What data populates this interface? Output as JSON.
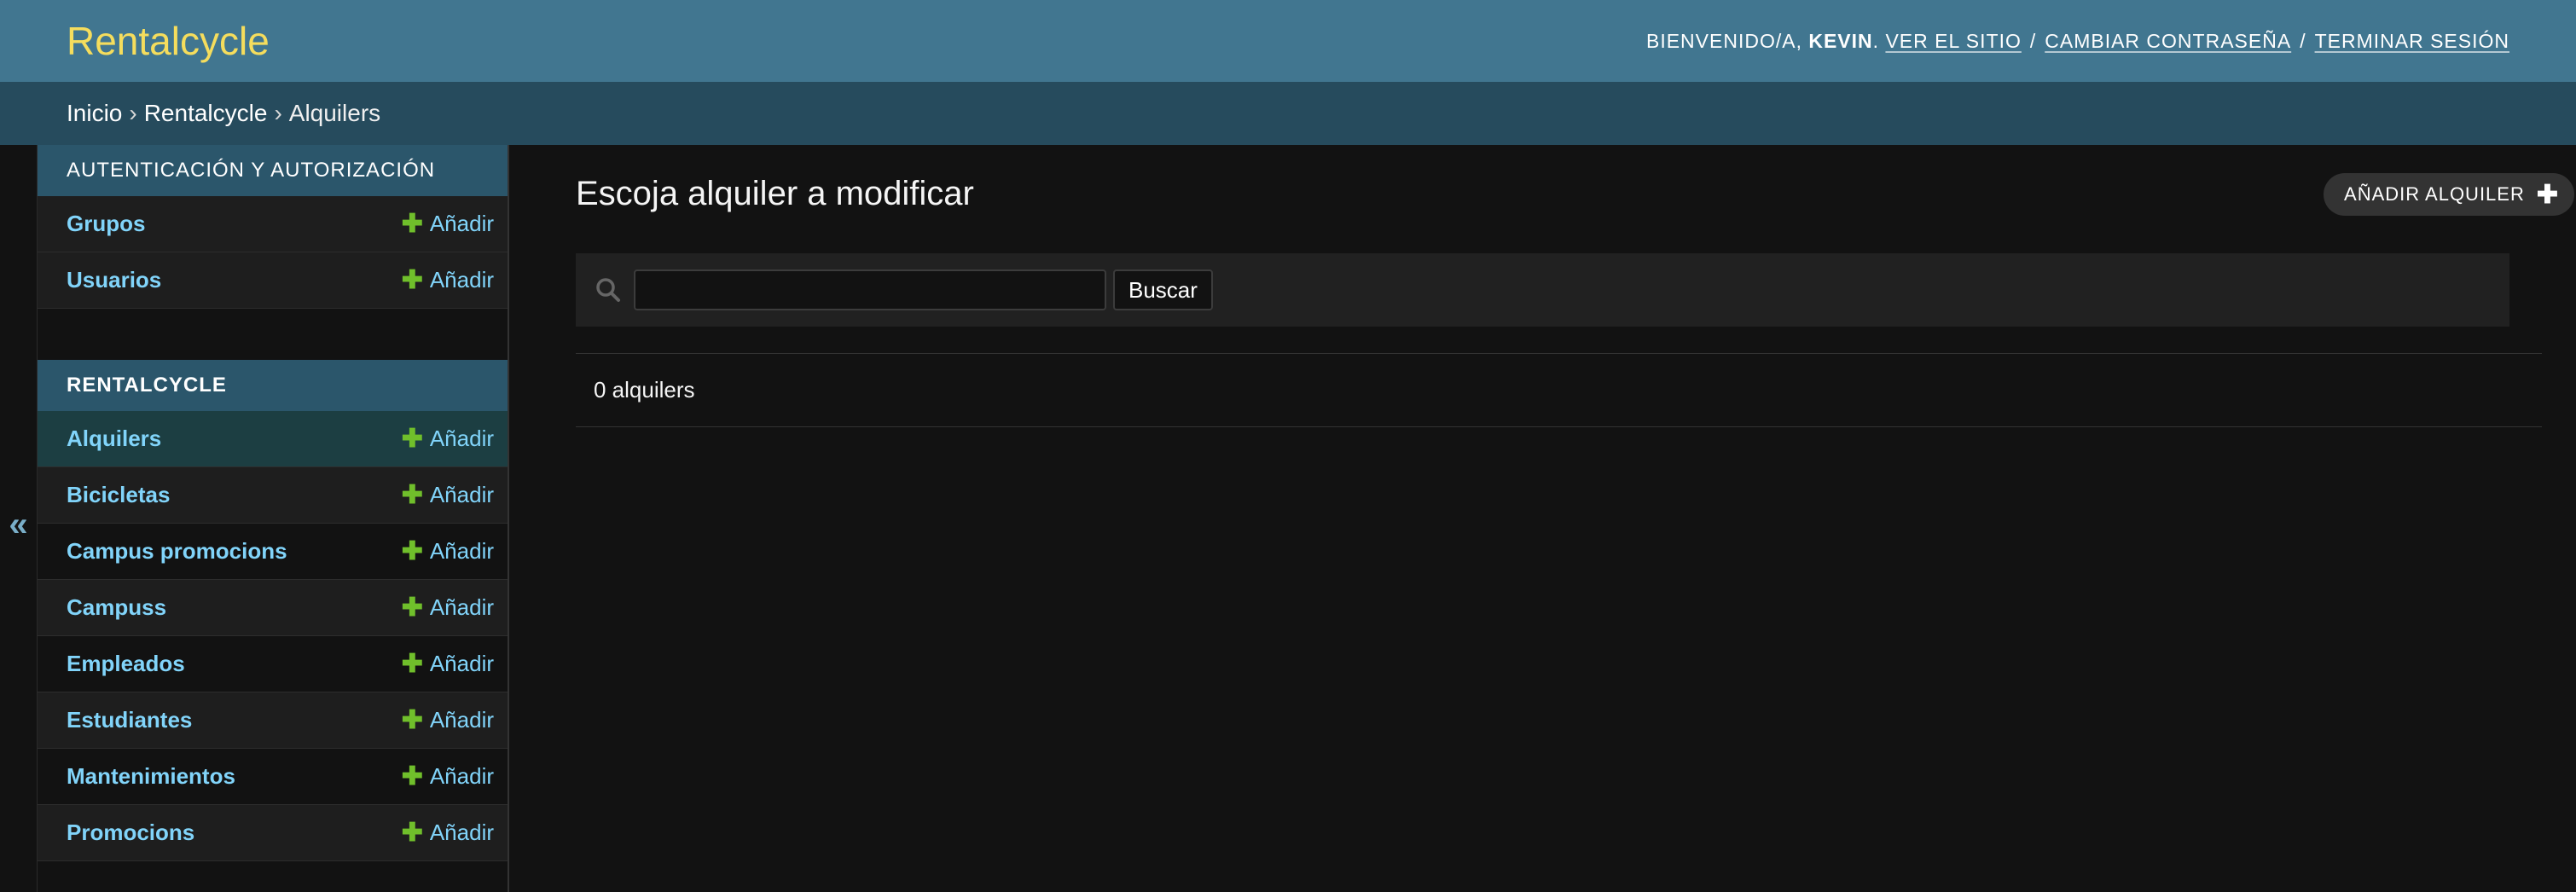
{
  "header": {
    "site_name": "Rentalcycle",
    "welcome_prefix": "BIENVENIDO/A,",
    "username": "KEVIN",
    "after_user": ".",
    "links": [
      "VER EL SITIO",
      "CAMBIAR CONTRASEÑA",
      "TERMINAR SESIÓN"
    ],
    "separator": "/"
  },
  "breadcrumbs": {
    "items": [
      "Inicio",
      "Rentalcycle",
      "Alquilers"
    ],
    "separator": "›"
  },
  "toggle": {
    "label": "«"
  },
  "sidebar": {
    "modules": [
      {
        "caption": "AUTENTICACIÓN Y AUTORIZACIÓN",
        "items": [
          {
            "label": "Grupos",
            "add": "Añadir"
          },
          {
            "label": "Usuarios",
            "add": "Añadir"
          }
        ]
      },
      {
        "caption": "RENTALCYCLE",
        "items": [
          {
            "label": "Alquilers",
            "add": "Añadir"
          },
          {
            "label": "Bicicletas",
            "add": "Añadir"
          },
          {
            "label": "Campus promocions",
            "add": "Añadir"
          },
          {
            "label": "Campuss",
            "add": "Añadir"
          },
          {
            "label": "Empleados",
            "add": "Añadir"
          },
          {
            "label": "Estudiantes",
            "add": "Añadir"
          },
          {
            "label": "Mantenimientos",
            "add": "Añadir"
          },
          {
            "label": "Promocions",
            "add": "Añadir"
          }
        ]
      }
    ]
  },
  "content": {
    "title": "Escoja alquiler a modificar",
    "add_button": "AÑADIR ALQUILER",
    "search": {
      "value": "",
      "button": "Buscar"
    },
    "result_count": "0 alquilers"
  },
  "colors": {
    "header_bg": "#417690",
    "site_name": "#f5dd5d",
    "breadcrumbs_bg": "#264b5d",
    "link": "#81d4fa",
    "add_plus": "#70bf2b"
  }
}
